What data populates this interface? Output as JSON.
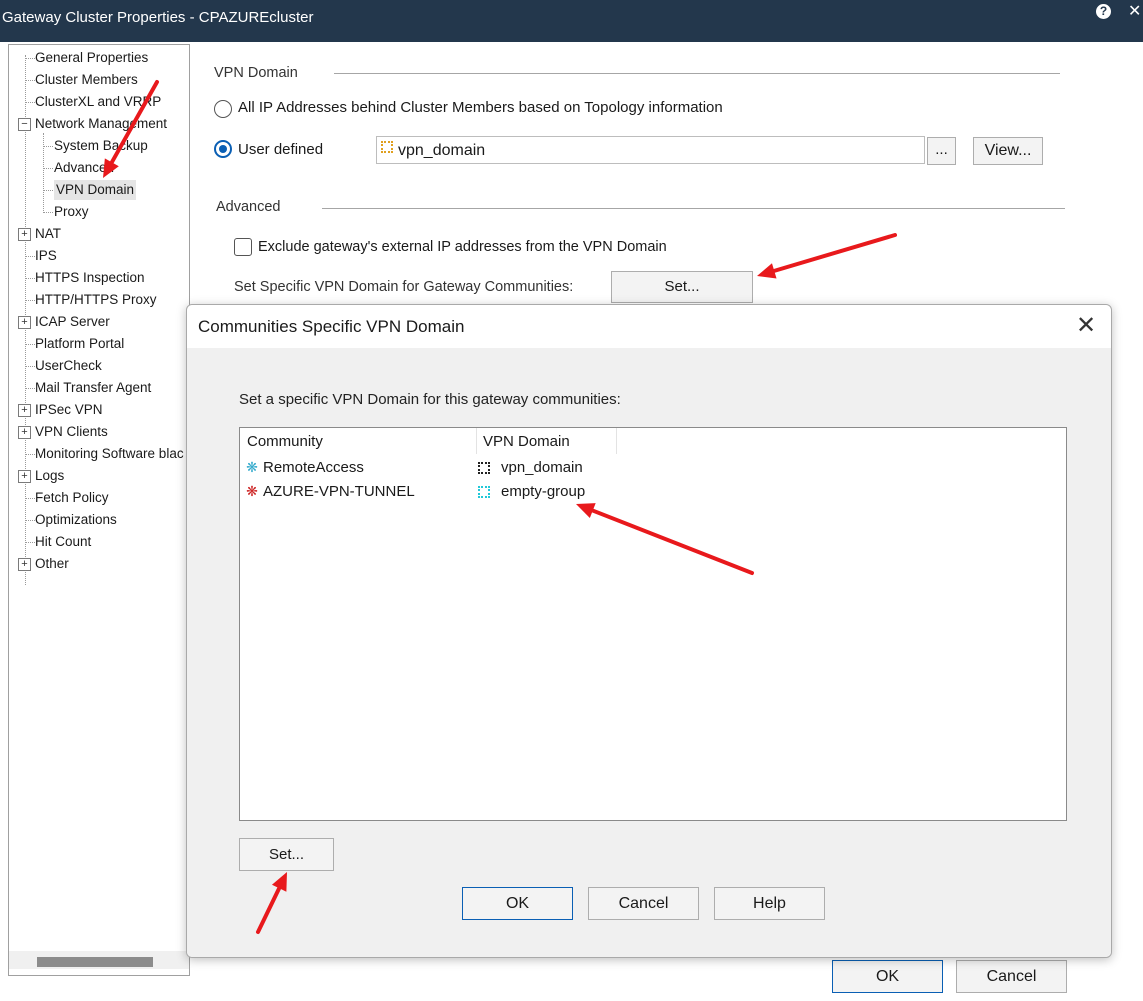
{
  "window": {
    "title": "Gateway Cluster Properties - CPAZUREcluster",
    "help_glyph": "?",
    "close_glyph": "✕"
  },
  "tree": {
    "items": [
      {
        "label": "General Properties",
        "expander": false
      },
      {
        "label": "Cluster Members",
        "expander": false
      },
      {
        "label": "ClusterXL and VRRP",
        "expander": false
      },
      {
        "label": "Network Management",
        "expander": "minus"
      },
      {
        "label": "System Backup",
        "child": true
      },
      {
        "label": "Advanced",
        "child": true
      },
      {
        "label": "VPN Domain",
        "child": true,
        "selected": true
      },
      {
        "label": "Proxy",
        "child": true
      },
      {
        "label": "NAT",
        "expander": "plus"
      },
      {
        "label": "IPS",
        "expander": false
      },
      {
        "label": "HTTPS Inspection",
        "expander": false
      },
      {
        "label": "HTTP/HTTPS Proxy",
        "expander": false
      },
      {
        "label": "ICAP Server",
        "expander": "plus"
      },
      {
        "label": "Platform Portal",
        "expander": false
      },
      {
        "label": "UserCheck",
        "expander": false
      },
      {
        "label": "Mail Transfer Agent",
        "expander": false
      },
      {
        "label": "IPSec VPN",
        "expander": "plus"
      },
      {
        "label": "VPN Clients",
        "expander": "plus"
      },
      {
        "label": "Monitoring Software blac",
        "expander": false
      },
      {
        "label": "Logs",
        "expander": "plus"
      },
      {
        "label": "Fetch Policy",
        "expander": false
      },
      {
        "label": "Optimizations",
        "expander": false
      },
      {
        "label": "Hit Count",
        "expander": false
      },
      {
        "label": "Other",
        "expander": "plus"
      }
    ]
  },
  "vpn_domain_section": {
    "heading": "VPN Domain",
    "radio_all": "All IP Addresses behind Cluster Members based on Topology information",
    "radio_user_defined": "User defined",
    "selected": "user_defined",
    "domain_value": "vpn_domain",
    "browse_label": "...",
    "view_label": "View..."
  },
  "advanced_section": {
    "heading": "Advanced",
    "exclude_label": "Exclude gateway's external IP addresses from the VPN Domain",
    "exclude_checked": false,
    "communities_label": "Set Specific VPN Domain for Gateway Communities:",
    "set_label": "Set..."
  },
  "main_buttons": {
    "ok": "OK",
    "cancel": "Cancel"
  },
  "dialog": {
    "title": "Communities Specific VPN Domain",
    "close_glyph": "✕",
    "instruction": "Set a specific VPN Domain for this gateway communities:",
    "columns": [
      "Community",
      "VPN Domain"
    ],
    "rows": [
      {
        "community": "RemoteAccess",
        "community_color": "#33aacc",
        "vpn_domain": "vpn_domain",
        "domain_icon_color": "#222222"
      },
      {
        "community": "AZURE-VPN-TUNNEL",
        "community_color": "#cc2222",
        "vpn_domain": "empty-group",
        "domain_icon_color": "#22c8d8"
      }
    ],
    "set_label": "Set...",
    "ok_label": "OK",
    "cancel_label": "Cancel",
    "help_label": "Help"
  },
  "annotation_color": "#e8191c"
}
